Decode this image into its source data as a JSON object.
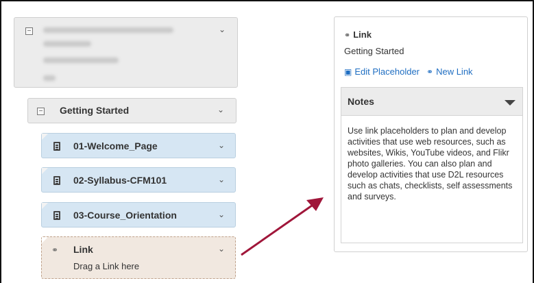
{
  "course": {
    "collapse_icon": "minus-square-icon",
    "expand_icon": "chevron-down-icon"
  },
  "module": {
    "title": "Getting Started"
  },
  "topics": [
    {
      "title": "01-Welcome_Page",
      "icon": "document-icon"
    },
    {
      "title": "02-Syllabus-CFM101",
      "icon": "document-icon"
    },
    {
      "title": "03-Course_Orientation",
      "icon": "document-icon"
    }
  ],
  "link_placeholder": {
    "title": "Link",
    "subtitle": "Drag a Link here",
    "icon": "link-icon"
  },
  "panel": {
    "title": "Link",
    "subtitle": "Getting Started",
    "actions": [
      {
        "label": "Edit Placeholder",
        "icon": "edit-placeholder-icon"
      },
      {
        "label": "New Link",
        "icon": "link-icon"
      }
    ],
    "notes": {
      "heading": "Notes",
      "body": "Use link placeholders to plan and develop activities that use web resources, such as websites, Wikis, YouTube videos, and Flikr photo galleries. You can also plan and develop activities that use D2L resources such as chats, checklists, self assessments and surveys."
    }
  },
  "colors": {
    "accent_link": "#1f6ec2",
    "topic_bg": "#d6e6f3",
    "arrow": "#a0163a"
  }
}
